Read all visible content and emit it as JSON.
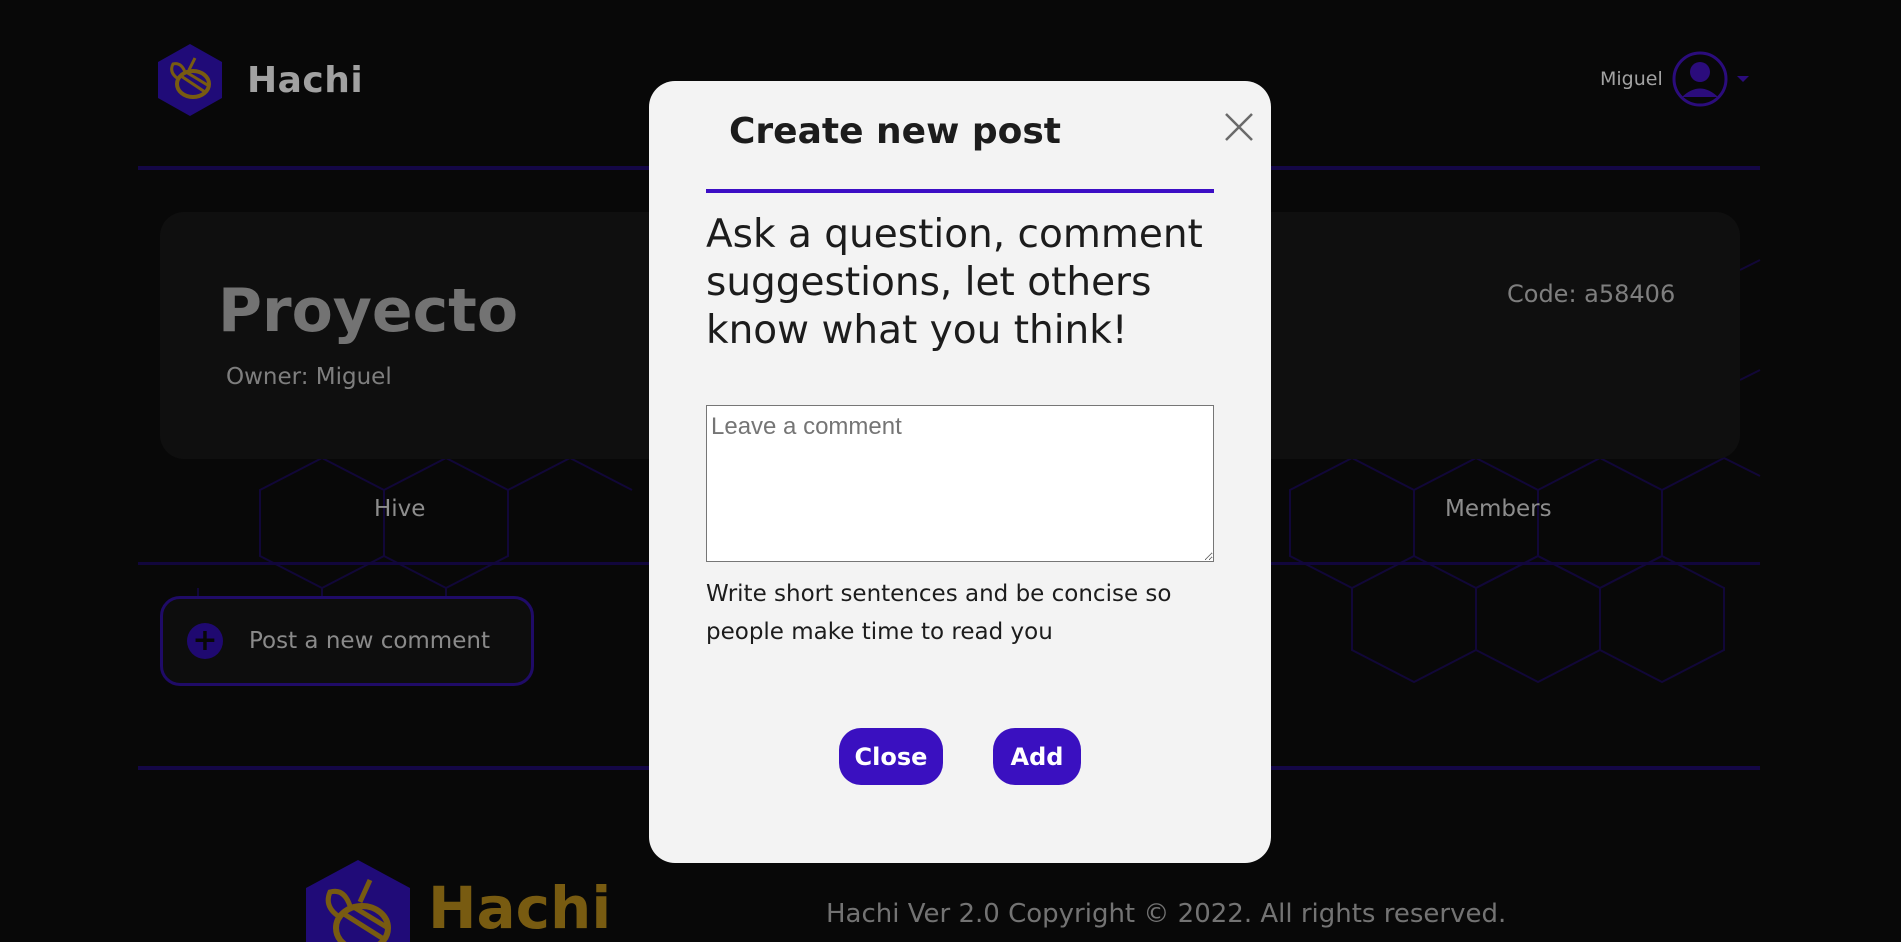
{
  "header": {
    "logo_text": "Hachi",
    "user_name": "Miguel"
  },
  "project": {
    "title": "Proyecto",
    "owner": "Owner: Miguel",
    "code": "Code: a58406"
  },
  "tabs": [
    {
      "label": "Hive"
    },
    {
      "label": "Members"
    }
  ],
  "post_button": {
    "label": "Post a new comment"
  },
  "footer": {
    "logo_text": "Hachi",
    "copyright": "Hachi Ver 2.0 Copyright © 2022. All rights reserved."
  },
  "modal": {
    "title": "Create new post",
    "prompt": "Ask a question, comment suggestions, let others know what you think!",
    "comment_placeholder": "Leave a comment",
    "comment_value": "",
    "hint": "Write short sentences and be concise so people make time to read you",
    "close_label": "Close",
    "add_label": "Add"
  },
  "colors": {
    "accent": "#3a10c0",
    "background": "#0b0b0b",
    "logo_gold": "#a07a17",
    "modal_bg": "#f3f3f3"
  },
  "icons": {
    "logo": "hachi-bee-hexagon-icon",
    "user": "user-avatar-icon",
    "dropdown": "caret-down-icon",
    "close": "close-x-icon",
    "plus": "plus-circle-icon"
  }
}
